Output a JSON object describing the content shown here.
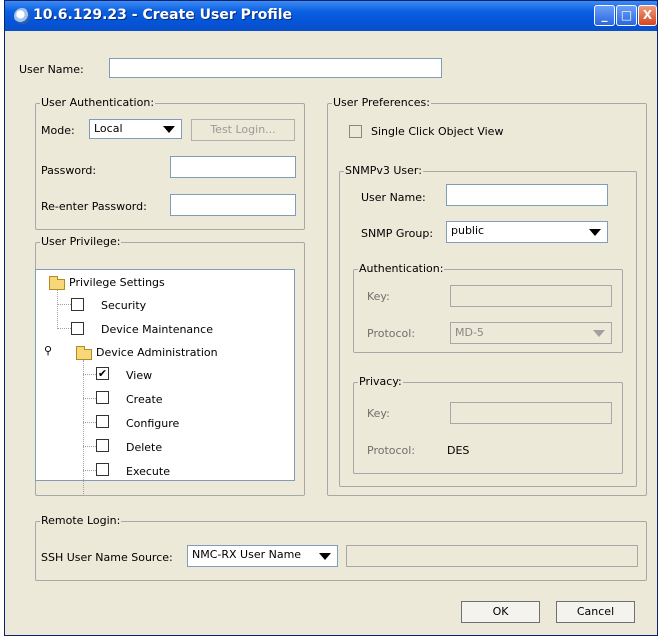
{
  "window": {
    "title": "10.6.129.23 - Create User Profile",
    "controls": {
      "minimize": "_",
      "maximize": "□",
      "close": "X"
    }
  },
  "user_name": {
    "label": "User Name:",
    "value": ""
  },
  "auth": {
    "legend": "User Authentication:",
    "mode_label": "Mode:",
    "mode_value": "Local",
    "test_login": "Test Login...",
    "password_label": "Password:",
    "reenter_label": "Re-enter Password:"
  },
  "prefs": {
    "legend": "User Preferences:",
    "single_click": {
      "label": "Single Click Object View",
      "checked": false
    }
  },
  "snmp": {
    "legend": "SNMPv3 User:",
    "user_name_label": "User Name:",
    "group_label": "SNMP Group:",
    "group_value": "public",
    "authentication": {
      "legend": "Authentication:",
      "key_label": "Key:",
      "protocol_label": "Protocol:",
      "protocol_value": "MD-5"
    },
    "privacy": {
      "legend": "Privacy:",
      "key_label": "Key:",
      "protocol_label": "Protocol:",
      "protocol_value": "DES"
    }
  },
  "privilege": {
    "legend": "User Privilege:",
    "root": "Privilege Settings",
    "security": {
      "label": "Security",
      "checked": false
    },
    "device_maintenance": {
      "label": "Device Maintenance",
      "checked": false
    },
    "device_admin": "Device Administration",
    "view": {
      "label": "View",
      "checked": true,
      "mark": "✔"
    },
    "create": {
      "label": "Create",
      "checked": false
    },
    "configure": {
      "label": "Configure",
      "checked": false
    },
    "delete": {
      "label": "Delete",
      "checked": false
    },
    "execute": {
      "label": "Execute",
      "checked": false
    }
  },
  "remote": {
    "legend": "Remote Login:",
    "ssh_label": "SSH User Name Source:",
    "ssh_value": "NMC-RX User Name",
    "ssh_extra": ""
  },
  "buttons": {
    "ok": "OK",
    "cancel": "Cancel"
  }
}
